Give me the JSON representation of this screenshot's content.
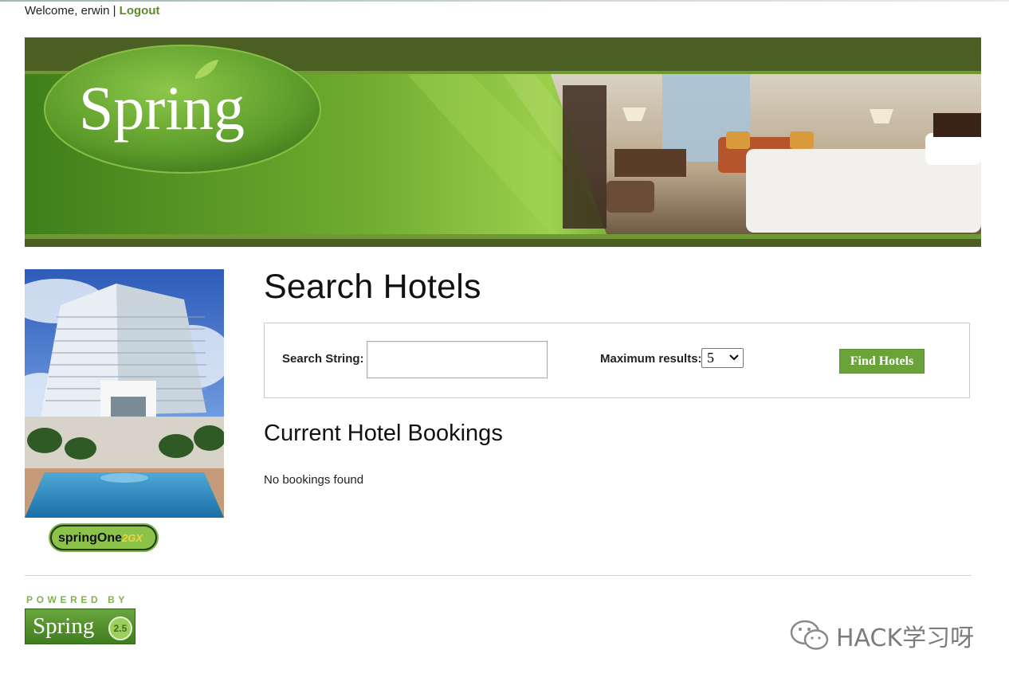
{
  "header": {
    "welcome_text": "Welcome, erwin |",
    "logout_label": "Logout"
  },
  "banner": {
    "logo_text": "Spring"
  },
  "sidebar": {
    "badge_text": "springOne",
    "badge_suffix": "2GX"
  },
  "main": {
    "title": "Search Hotels",
    "search": {
      "label": "Search String:",
      "value": "",
      "max_results_label": "Maximum results:",
      "max_results_value": "5",
      "submit_label": "Find Hotels"
    },
    "bookings": {
      "title": "Current Hotel Bookings",
      "empty_text": "No bookings found"
    }
  },
  "footer": {
    "powered_by": "POWERED BY",
    "powered_logo_text": "Spring",
    "watermark_text": "HACK学习呀"
  },
  "colors": {
    "link_green": "#5f8a2c",
    "button_green": "#6aa33a",
    "banner_dark": "#4b5f23"
  }
}
